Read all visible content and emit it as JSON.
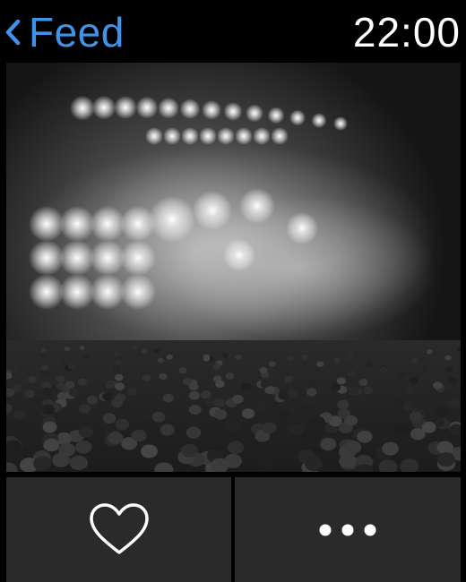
{
  "header": {
    "back_label": "Feed",
    "time": "22:00"
  },
  "photo": {
    "subject": "concert-stage-crowd"
  },
  "actions": {
    "like_icon": "heart-icon",
    "more_icon": "ellipsis-icon"
  },
  "colors": {
    "accent": "#3f94e9",
    "background": "#000000",
    "button_bg": "#2a2a2a"
  }
}
